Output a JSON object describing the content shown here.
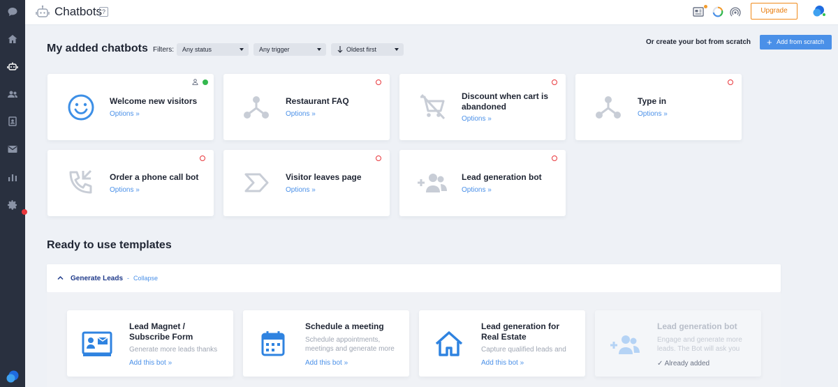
{
  "topbar": {
    "title": "Chatbots",
    "help": "?",
    "upgrade_label": "Upgrade"
  },
  "icons": {
    "rail": [
      "chat-icon",
      "home-icon",
      "bot-icon",
      "users-icon",
      "contacts-icon",
      "inbox-icon",
      "stats-icon",
      "settings-icon"
    ],
    "topbar": [
      "knowledge-icon",
      "progress-icon",
      "broadcast-icon",
      "avatar-logo"
    ]
  },
  "header": {
    "title": "My added chatbots",
    "filters_label": "Filters:",
    "status_filter": "Any status",
    "trigger_filter": "Any trigger",
    "sort_filter": "Oldest first",
    "or_create": "Or create your bot from scratch",
    "add_scratch": "Add from scratch"
  },
  "bots": [
    {
      "name": "Welcome new visitors",
      "options": "Options »",
      "status": "active"
    },
    {
      "name": "Restaurant FAQ",
      "options": "Options »",
      "status": "inactive"
    },
    {
      "name": "Discount when cart is abandoned",
      "options": "Options »",
      "status": "inactive"
    },
    {
      "name": "Type in",
      "options": "Options »",
      "status": "inactive"
    },
    {
      "name": "Order a phone call bot",
      "options": "Options »",
      "status": "inactive"
    },
    {
      "name": "Visitor leaves page",
      "options": "Options »",
      "status": "inactive"
    },
    {
      "name": "Lead generation bot",
      "options": "Options »",
      "status": "inactive"
    }
  ],
  "templates": {
    "title": "Ready to use templates",
    "group": {
      "label": "Generate Leads",
      "separator": "-",
      "collapse": "Collapse"
    },
    "items": [
      {
        "name": "Lead Magnet / Subscribe Form",
        "desc": "Generate more leads thanks",
        "action": "Add this bot »"
      },
      {
        "name": "Schedule a meeting",
        "desc": "Schedule appointments, meetings and generate more",
        "action": "Add this bot »"
      },
      {
        "name": "Lead generation for Real Estate",
        "desc": "Capture qualified leads and",
        "action": "Add this bot »"
      },
      {
        "name": "Lead generation bot",
        "desc": "Engage and generate more leads. The Bot will ask you",
        "action": "Already added"
      }
    ]
  },
  "colors": {
    "accent": "#4a90e8",
    "rail": "#29303f",
    "upgrade": "#f08a1a",
    "inactive": "#e8363b",
    "active": "#33b84e"
  }
}
